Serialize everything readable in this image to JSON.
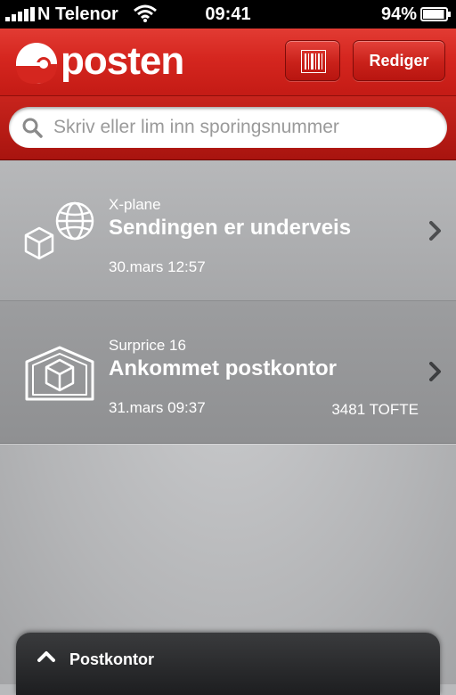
{
  "status_bar": {
    "carrier": "N Telenor",
    "time": "09:41",
    "battery": "94%",
    "battery_level": 0.94,
    "signal_bars": 5
  },
  "header": {
    "logo_text": "posten",
    "barcode_icon": "barcode-icon",
    "edit_label": "Rediger"
  },
  "search": {
    "placeholder": "Skriv eller lim inn sporingsnummer",
    "value": ""
  },
  "shipments": [
    {
      "sender": "X-plane",
      "status": "Sendingen er underveis",
      "date": "30.mars 12:57",
      "location": "",
      "icon": "package-globe-icon"
    },
    {
      "sender": "Surprice 16",
      "status": "Ankommet postkontor",
      "date": "31.mars 09:37",
      "location": "3481 TOFTE",
      "icon": "package-house-icon"
    }
  ],
  "drawer": {
    "label": "Postkontor",
    "icon": "chevron-up-icon"
  },
  "colors": {
    "brand_red": "#d5261f",
    "list_bg": "#b7b8ba",
    "drawer_bg": "#2a2b2d"
  }
}
